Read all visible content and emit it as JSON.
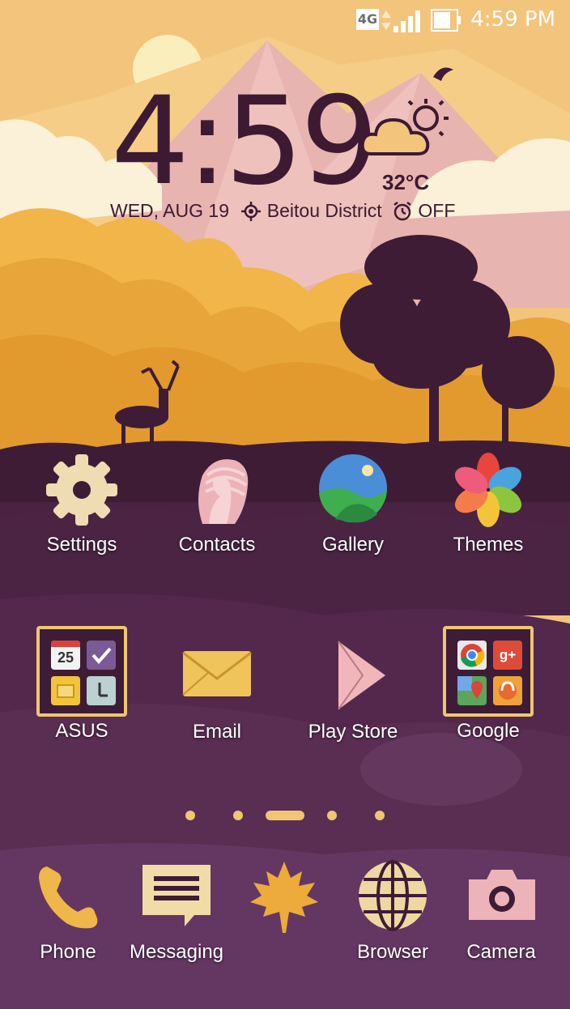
{
  "status_bar": {
    "network_badge": "4G",
    "time": "4:59 PM"
  },
  "widget": {
    "clock_hour": "4",
    "clock_sep": ":",
    "clock_minutes": "59",
    "temperature": "32°C",
    "date": "WED, AUG 19",
    "location": "Beitou District",
    "alarm": "OFF"
  },
  "apps_row1": [
    {
      "label": "Settings"
    },
    {
      "label": "Contacts"
    },
    {
      "label": "Gallery"
    },
    {
      "label": "Themes"
    }
  ],
  "apps_row2": [
    {
      "label": "ASUS",
      "calendar_day": "25"
    },
    {
      "label": "Email"
    },
    {
      "label": "Play Store"
    },
    {
      "label": "Google"
    }
  ],
  "dock": [
    {
      "label": "Phone"
    },
    {
      "label": "Messaging"
    },
    {
      "label": ""
    },
    {
      "label": "Browser"
    },
    {
      "label": "Camera"
    }
  ],
  "page_indicator": {
    "pages": 5,
    "current": 3
  },
  "colors": {
    "sky": "#f3c47c",
    "mountain": "#e9b3b3",
    "forest": "#e8a53a",
    "plum": "#3e1c36",
    "ground": "#54284c",
    "accent": "#efc673"
  }
}
